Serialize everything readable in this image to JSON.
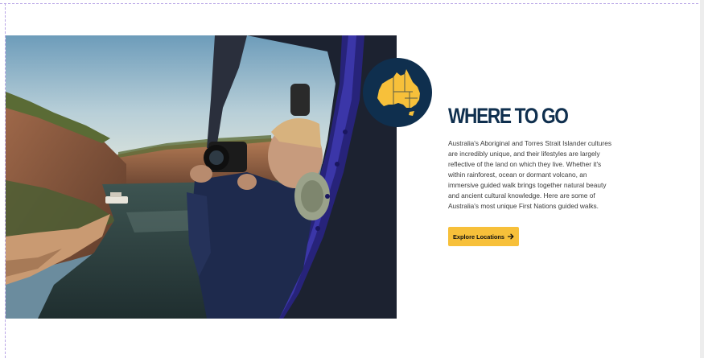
{
  "section": {
    "heading": "WHERE TO GO",
    "description": "Australia's Aboriginal and Torres Strait Islander cultures are incredibly unique, and their lifestyles are largely reflective of the land on which they live. Whether it's within rainforest, ocean or dormant volcano, an immersive guided walk brings together natural beauty and ancient cultural knowledge. Here are some of Australia's most unique First Nations guided walks.",
    "cta_label": "Explore Locations",
    "cta_icon": "arrow-right-icon"
  },
  "media": {
    "photo_icon": "helicopter-gorge-photo",
    "badge_icon": "australia-map-icon"
  },
  "colors": {
    "heading": "#0f2f4e",
    "badge_background": "#0f2f4e",
    "map_fill": "#f7c03a",
    "cta_background": "#f7c03a",
    "body_text": "#3a3a3a"
  }
}
